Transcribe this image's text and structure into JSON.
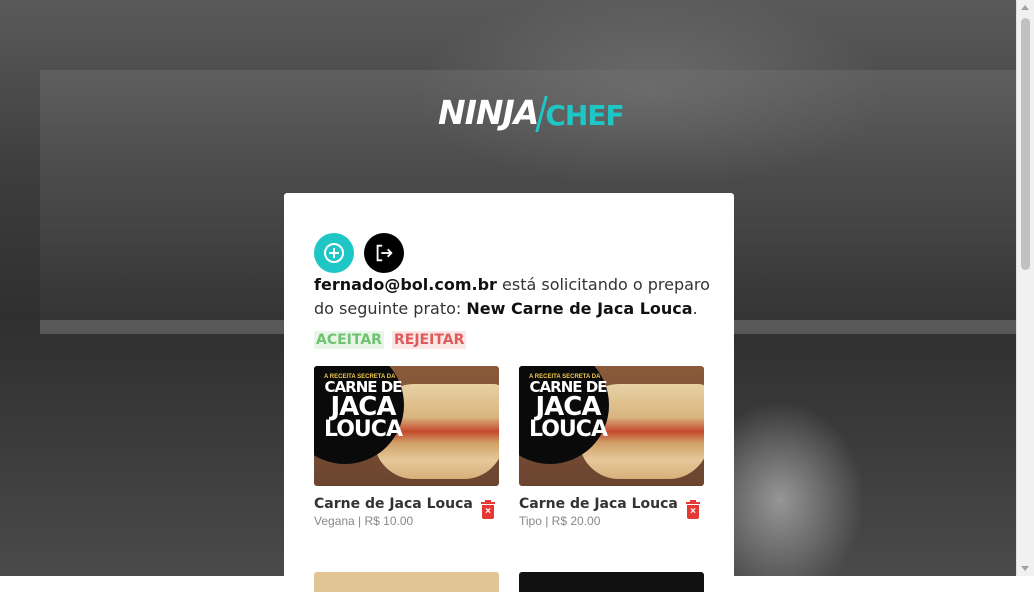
{
  "logo": {
    "part1": "NINJA",
    "part2": "CHEF"
  },
  "toolbar": {
    "add_icon": "add-circle-icon",
    "logout_icon": "logout-icon"
  },
  "request": {
    "email": "fernado@bol.com.br",
    "text_middle": " está solicitando o preparo do seguinte prato: ",
    "dish": "New Carne de Jaca Louca",
    "end": "."
  },
  "actions": {
    "accept_label": "ACEITAR",
    "reject_label": "REJEITAR"
  },
  "dishes": [
    {
      "name": "Carne de Jaca Louca",
      "subtitle": "Vegana | R$ 10.00",
      "image_small": "A RECEITA SECRETA DA",
      "image_l1": "CARNE DE",
      "image_l2": "JACA",
      "image_l3": "LOUCA"
    },
    {
      "name": "Carne de Jaca Louca",
      "subtitle": "Tipo | R$ 20.00",
      "image_small": "A RECEITA SECRETA DA",
      "image_l1": "CARNE DE",
      "image_l2": "JACA",
      "image_l3": "LOUCA"
    }
  ],
  "colors": {
    "accent": "#1ec6c6",
    "accept": "#6ec46e",
    "reject": "#e05a5a",
    "delete": "#e53935"
  }
}
